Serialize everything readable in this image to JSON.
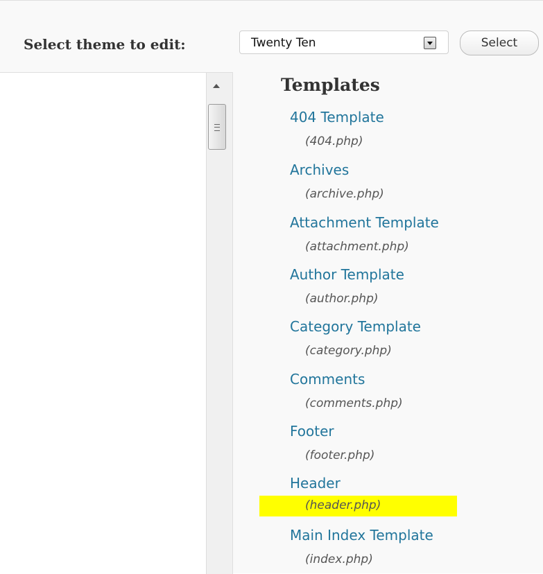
{
  "theme_selector": {
    "label": "Select theme to edit:",
    "current_theme": "Twenty Ten",
    "select_button_label": "Select"
  },
  "templates": {
    "heading": "Templates",
    "items": [
      {
        "name": "404 Template",
        "file": "(404.php)"
      },
      {
        "name": "Archives",
        "file": "(archive.php)"
      },
      {
        "name": "Attachment Template",
        "file": "(attachment.php)"
      },
      {
        "name": "Author Template",
        "file": "(author.php)"
      },
      {
        "name": "Category Template",
        "file": "(category.php)"
      },
      {
        "name": "Comments",
        "file": "(comments.php)"
      },
      {
        "name": "Footer",
        "file": "(footer.php)"
      },
      {
        "name": "Header",
        "file": "(header.php)",
        "highlighted": true
      },
      {
        "name": "Main Index Template",
        "file": "(index.php)"
      }
    ]
  },
  "colors": {
    "link": "#21759b",
    "highlight": "#ffff00",
    "filename": "#555555"
  }
}
